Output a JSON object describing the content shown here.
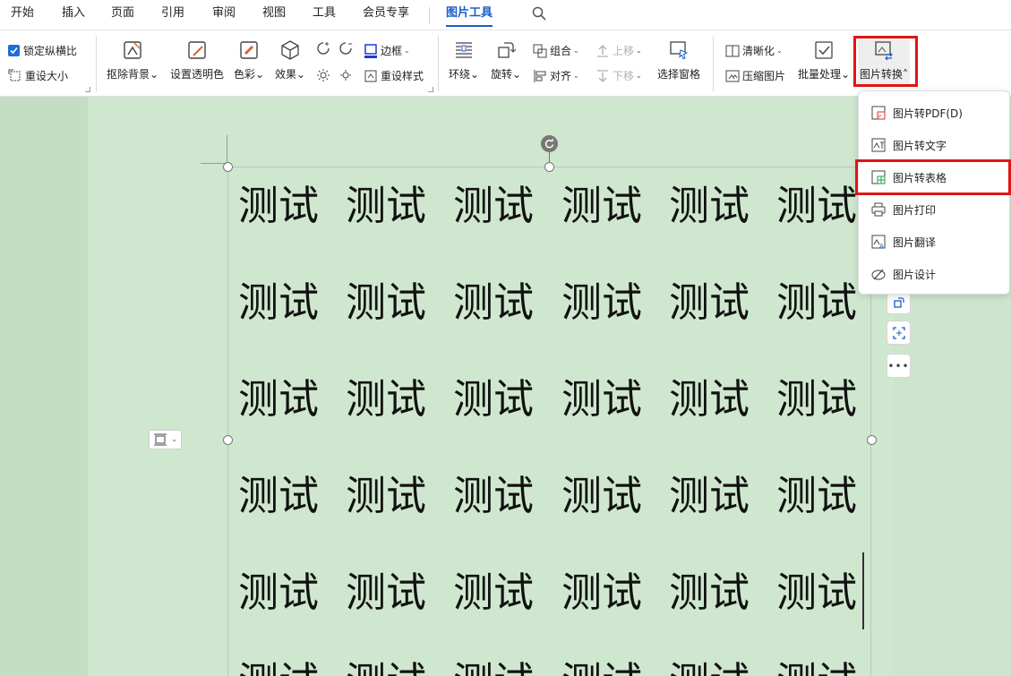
{
  "menubar": {
    "tabs": [
      "开始",
      "插入",
      "页面",
      "引用",
      "审阅",
      "视图",
      "工具",
      "会员专享",
      "图片工具"
    ],
    "active_tab": "图片工具"
  },
  "ribbon": {
    "lock_ratio": "锁定纵横比",
    "reset_size": "重设大小",
    "remove_bg": "抠除背景",
    "set_transparent": "设置透明色",
    "color": "色彩",
    "effect": "效果",
    "border": "边框",
    "reset_style": "重设样式",
    "wrap": "环绕",
    "rotate": "旋转",
    "group": "组合",
    "align": "对齐",
    "move_up": "上移",
    "move_down": "下移",
    "select_pane": "选择窗格",
    "sharpen": "清晰化",
    "compress": "压缩图片",
    "batch": "批量处理",
    "convert": "图片转换"
  },
  "document": {
    "cell_text": "测试",
    "rows": 6,
    "cols": 6
  },
  "dropdown": {
    "items": [
      "图片转PDF(D)",
      "图片转文字",
      "图片转表格",
      "图片打印",
      "图片翻译",
      "图片设计"
    ],
    "highlighted": "图片转表格"
  },
  "colors": {
    "accent": "#1a5dc8",
    "highlight_box": "#e01515",
    "canvas_bg": "#cfe7cf"
  }
}
